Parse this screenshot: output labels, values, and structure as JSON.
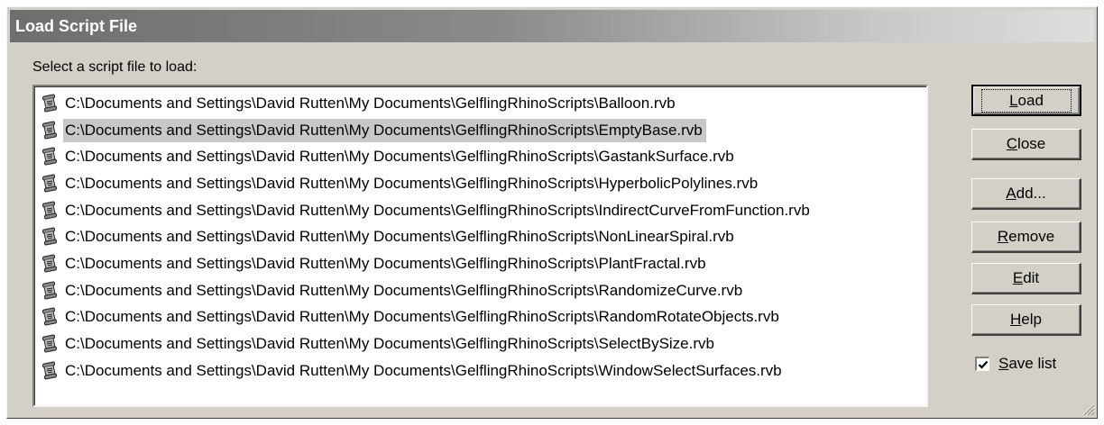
{
  "dialog": {
    "title": "Load Script File",
    "prompt": "Select a script file to load:"
  },
  "files": [
    {
      "path": "C:\\Documents and Settings\\David Rutten\\My Documents\\GelflingRhinoScripts\\Balloon.rvb",
      "selected": false
    },
    {
      "path": "C:\\Documents and Settings\\David Rutten\\My Documents\\GelflingRhinoScripts\\EmptyBase.rvb",
      "selected": true
    },
    {
      "path": "C:\\Documents and Settings\\David Rutten\\My Documents\\GelflingRhinoScripts\\GastankSurface.rvb",
      "selected": false
    },
    {
      "path": "C:\\Documents and Settings\\David Rutten\\My Documents\\GelflingRhinoScripts\\HyperbolicPolylines.rvb",
      "selected": false
    },
    {
      "path": "C:\\Documents and Settings\\David Rutten\\My Documents\\GelflingRhinoScripts\\IndirectCurveFromFunction.rvb",
      "selected": false
    },
    {
      "path": "C:\\Documents and Settings\\David Rutten\\My Documents\\GelflingRhinoScripts\\NonLinearSpiral.rvb",
      "selected": false
    },
    {
      "path": "C:\\Documents and Settings\\David Rutten\\My Documents\\GelflingRhinoScripts\\PlantFractal.rvb",
      "selected": false
    },
    {
      "path": "C:\\Documents and Settings\\David Rutten\\My Documents\\GelflingRhinoScripts\\RandomizeCurve.rvb",
      "selected": false
    },
    {
      "path": "C:\\Documents and Settings\\David Rutten\\My Documents\\GelflingRhinoScripts\\RandomRotateObjects.rvb",
      "selected": false
    },
    {
      "path": "C:\\Documents and Settings\\David Rutten\\My Documents\\GelflingRhinoScripts\\SelectBySize.rvb",
      "selected": false
    },
    {
      "path": "C:\\Documents and Settings\\David Rutten\\My Documents\\GelflingRhinoScripts\\WindowSelectSurfaces.rvb",
      "selected": false
    }
  ],
  "buttons": {
    "load": {
      "label": "Load",
      "mnemonic": "L",
      "rest": "oad"
    },
    "close": {
      "label": "Close",
      "mnemonic": "C",
      "rest": "lose"
    },
    "add": {
      "label": "Add...",
      "mnemonic": "A",
      "rest": "dd..."
    },
    "remove": {
      "label": "Remove",
      "mnemonic": "R",
      "rest": "emove"
    },
    "edit": {
      "label": "Edit",
      "mnemonic": "E",
      "rest": "dit"
    },
    "help": {
      "label": "Help",
      "mnemonic": "H",
      "rest": "elp"
    }
  },
  "save_list": {
    "label": "Save list",
    "mnemonic": "S",
    "rest": "ave list",
    "checked": true
  },
  "icons": {
    "file_item": "script-scroll-icon",
    "checkmark": "checkmark-icon",
    "resize": "resize-grip-icon"
  },
  "colors": {
    "selection": "#c8c8c8",
    "face": "#d4d0c8"
  }
}
